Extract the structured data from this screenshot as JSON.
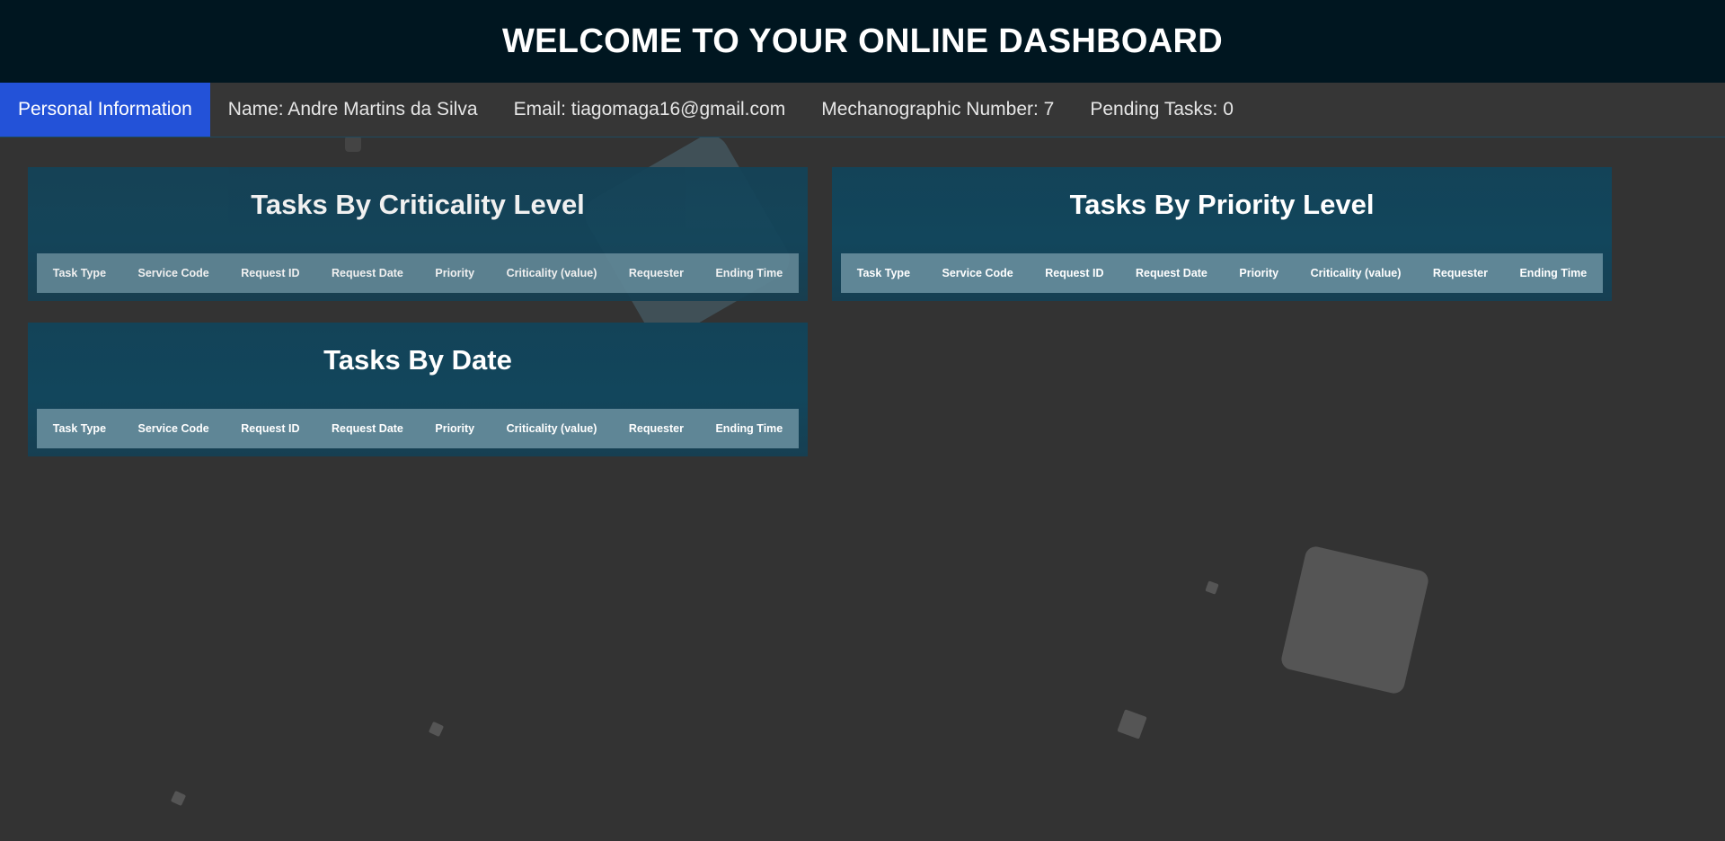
{
  "header": {
    "title": "WELCOME TO YOUR ONLINE DASHBOARD"
  },
  "info_bar": {
    "active_tab": "Personal Information",
    "name": "Name: Andre Martins da Silva",
    "email": "Email: tiagomaga16@gmail.com",
    "mechanographic_number": "Mechanographic Number: 7",
    "pending_tasks": "Pending Tasks: 0"
  },
  "columns": [
    "Task Type",
    "Service Code",
    "Request ID",
    "Request Date",
    "Priority",
    "Criticality (value)",
    "Requester",
    "Ending Time"
  ],
  "panels": {
    "criticality": {
      "title": "Tasks By Criticality Level"
    },
    "priority": {
      "title": "Tasks By Priority Level"
    },
    "date": {
      "title": "Tasks By Date"
    }
  },
  "colors": {
    "header_bg": "#001620",
    "page_bg": "#333333",
    "active_tab": "#2352d8",
    "panel_bg": "#134358",
    "table_header": "#5f8696"
  }
}
